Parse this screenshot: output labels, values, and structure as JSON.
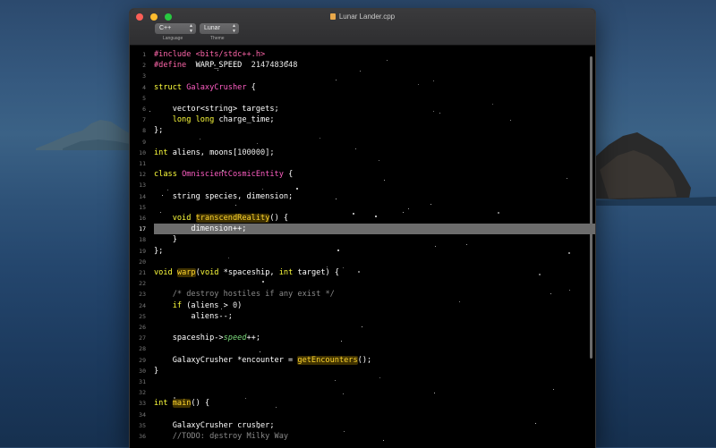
{
  "window": {
    "title": "Lunar Lander.cpp"
  },
  "toolbar": {
    "language": {
      "value": "C++",
      "caption": "Language"
    },
    "theme": {
      "value": "Lunar",
      "caption": "Theme"
    }
  },
  "editor": {
    "active_line": 17,
    "lines": [
      {
        "n": "1",
        "tokens": [
          [
            "pp",
            "#include <bits/stdc++.h>"
          ]
        ]
      },
      {
        "n": "2",
        "tokens": [
          [
            "pp",
            "#define"
          ],
          [
            "",
            "  WARP_SPEED  "
          ],
          [
            "num",
            "2147483648"
          ]
        ]
      },
      {
        "n": "3",
        "tokens": []
      },
      {
        "n": "4",
        "tokens": [
          [
            "kw",
            "struct"
          ],
          [
            "",
            " "
          ],
          [
            "cls",
            "GalaxyCrusher"
          ],
          [
            "",
            " {"
          ]
        ]
      },
      {
        "n": "5",
        "tokens": []
      },
      {
        "n": "6",
        "tokens": [
          [
            "",
            "    vector<string> targets;"
          ]
        ]
      },
      {
        "n": "7",
        "tokens": [
          [
            "",
            "    "
          ],
          [
            "kw",
            "long long"
          ],
          [
            "",
            " charge_time;"
          ]
        ]
      },
      {
        "n": "8",
        "tokens": [
          [
            "",
            "};"
          ]
        ]
      },
      {
        "n": "9",
        "tokens": []
      },
      {
        "n": "10",
        "tokens": [
          [
            "kw",
            "int"
          ],
          [
            "",
            " aliens, moons["
          ],
          [
            "num",
            "100000"
          ],
          [
            "",
            "];"
          ]
        ]
      },
      {
        "n": "11",
        "tokens": []
      },
      {
        "n": "12",
        "tokens": [
          [
            "kw",
            "class"
          ],
          [
            "",
            " "
          ],
          [
            "cls",
            "OmniscientCosmicEntity"
          ],
          [
            "",
            " {"
          ]
        ]
      },
      {
        "n": "13",
        "tokens": []
      },
      {
        "n": "14",
        "tokens": [
          [
            "",
            "    string species, dimension;"
          ]
        ]
      },
      {
        "n": "15",
        "tokens": []
      },
      {
        "n": "16",
        "tokens": [
          [
            "",
            "    "
          ],
          [
            "kw",
            "void"
          ],
          [
            "",
            " "
          ],
          [
            "hl",
            "transcendReality"
          ],
          [
            "",
            "() {"
          ]
        ]
      },
      {
        "n": "17",
        "tokens": [
          [
            "",
            "        dimension++;"
          ]
        ]
      },
      {
        "n": "18",
        "tokens": [
          [
            "",
            "    }"
          ]
        ]
      },
      {
        "n": "19",
        "tokens": [
          [
            "",
            "};"
          ]
        ]
      },
      {
        "n": "20",
        "tokens": []
      },
      {
        "n": "21",
        "tokens": [
          [
            "kw",
            "void"
          ],
          [
            "",
            " "
          ],
          [
            "hl",
            "warp"
          ],
          [
            "",
            "("
          ],
          [
            "kw",
            "void"
          ],
          [
            "",
            " *spaceship, "
          ],
          [
            "kw",
            "int"
          ],
          [
            "",
            " target) {"
          ]
        ]
      },
      {
        "n": "22",
        "tokens": []
      },
      {
        "n": "23",
        "tokens": [
          [
            "",
            "    "
          ],
          [
            "cm",
            "/* destroy hostiles if any exist */"
          ]
        ]
      },
      {
        "n": "24",
        "tokens": [
          [
            "",
            "    "
          ],
          [
            "kw",
            "if"
          ],
          [
            "",
            " (aliens > "
          ],
          [
            "num",
            "0"
          ],
          [
            "",
            ")"
          ]
        ]
      },
      {
        "n": "25",
        "tokens": [
          [
            "",
            "        aliens--;"
          ]
        ]
      },
      {
        "n": "26",
        "tokens": []
      },
      {
        "n": "27",
        "tokens": [
          [
            "",
            "    spaceship->"
          ],
          [
            "it",
            "speed"
          ],
          [
            "",
            "++;"
          ]
        ]
      },
      {
        "n": "28",
        "tokens": []
      },
      {
        "n": "29",
        "tokens": [
          [
            "",
            "    GalaxyCrusher *encounter = "
          ],
          [
            "hl",
            "getEncounters"
          ],
          [
            "",
            "();"
          ]
        ]
      },
      {
        "n": "30",
        "tokens": [
          [
            "",
            "}"
          ]
        ]
      },
      {
        "n": "31",
        "tokens": []
      },
      {
        "n": "32",
        "tokens": []
      },
      {
        "n": "33",
        "tokens": [
          [
            "kw",
            "int"
          ],
          [
            "",
            " "
          ],
          [
            "hl",
            "main"
          ],
          [
            "",
            "() {"
          ]
        ]
      },
      {
        "n": "34",
        "tokens": []
      },
      {
        "n": "35",
        "tokens": [
          [
            "",
            "    GalaxyCrusher crusher;"
          ]
        ]
      },
      {
        "n": "36",
        "tokens": [
          [
            "",
            "    "
          ],
          [
            "cm",
            "//TODO: destroy Milky Way"
          ]
        ]
      }
    ]
  }
}
